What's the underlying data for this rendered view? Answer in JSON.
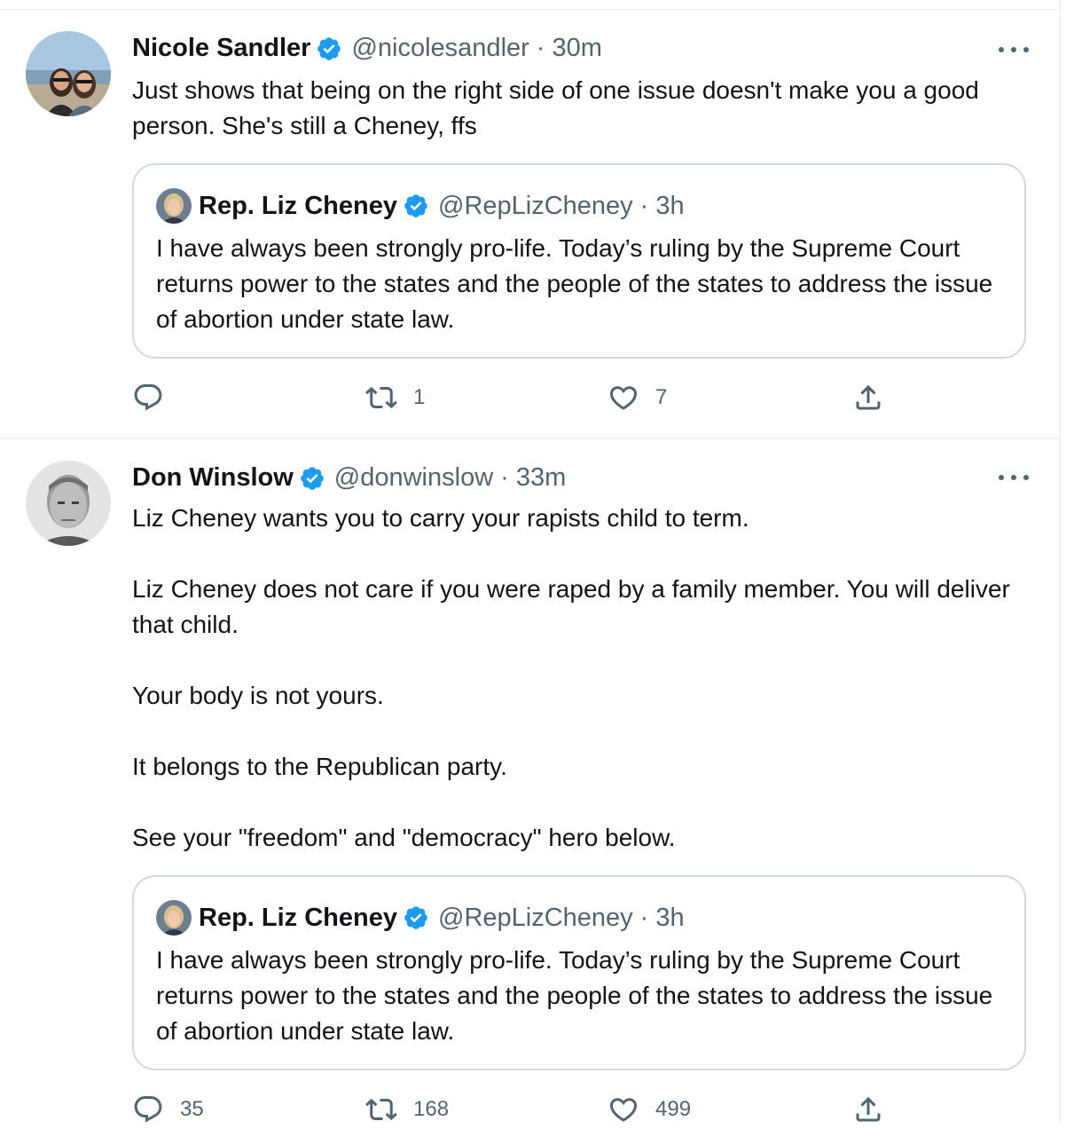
{
  "tweets": [
    {
      "name": "Nicole Sandler",
      "handle": "@nicolesandler",
      "separator": "·",
      "time": "30m",
      "paragraphs": [
        "Just shows that being on the right side of one issue doesn't make you a good person. She's still a Cheney, ffs"
      ],
      "quote": {
        "name": "Rep. Liz Cheney",
        "handle": "@RepLizCheney",
        "separator": "·",
        "time": "3h",
        "text": "I have always been strongly pro-life. Today’s ruling by the Supreme Court returns power to the states and the people of the states to address the issue of abortion under state law."
      },
      "stats": {
        "replies": "",
        "retweets": "1",
        "likes": "7"
      }
    },
    {
      "name": "Don Winslow",
      "handle": "@donwinslow",
      "separator": "·",
      "time": "33m",
      "paragraphs": [
        "Liz Cheney wants you to carry your rapists child to term.",
        "Liz Cheney does not care if you were raped by a family member. You will deliver that child.",
        "Your body is not yours.",
        "It belongs to the Republican party.",
        "See your \"freedom\" and \"democracy\" hero below."
      ],
      "quote": {
        "name": "Rep. Liz Cheney",
        "handle": "@RepLizCheney",
        "separator": "·",
        "time": "3h",
        "text": "I have always been strongly pro-life. Today’s ruling by the Supreme Court returns power to the states and the people of the states to address the issue of abortion under state law."
      },
      "stats": {
        "replies": "35",
        "retweets": "168",
        "likes": "499"
      }
    }
  ],
  "icons": {
    "verified": "verified-badge-icon",
    "more": "more-options-icon",
    "reply": "reply-icon",
    "retweet": "retweet-icon",
    "like": "like-icon",
    "share": "share-icon"
  },
  "colors": {
    "text": "#0f1419",
    "secondary": "#536471",
    "verified": "#1d9bf0",
    "border": "#cfd9de",
    "divider": "#eff3f4"
  }
}
